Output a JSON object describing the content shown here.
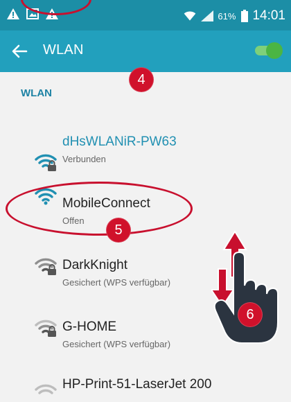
{
  "status_bar": {
    "battery_percent": "61%",
    "time": "14:01",
    "icons": [
      "warning-icon",
      "gallery-icon",
      "warning-icon",
      "wifi-icon",
      "signal-icon",
      "battery-icon"
    ]
  },
  "header": {
    "back_icon": "arrow-left-icon",
    "title": "WLAN",
    "toggle_state": "on"
  },
  "annotations": {
    "badge_4": "4",
    "badge_5": "5",
    "badge_6": "6"
  },
  "section": {
    "label": "WLAN"
  },
  "networks": [
    {
      "name": "dHsWLANiR-PW63",
      "status": "Verbunden",
      "secured": true
    },
    {
      "name": "MobileConnect",
      "status": "Offen",
      "secured": false
    },
    {
      "name": "DarkKnight",
      "status": "Gesichert (WPS verfügbar)",
      "secured": true
    },
    {
      "name": "G-HOME",
      "status": "Gesichert (WPS verfügbar)",
      "secured": true
    },
    {
      "name": "HP-Print-51-LaserJet 200",
      "status": "",
      "secured": false
    }
  ],
  "colors": {
    "status_bar": "#1c8ea6",
    "action_bar": "#22a0bd",
    "accent": "#2190b2",
    "badge": "#d0112b",
    "hand": "#2b3440"
  }
}
